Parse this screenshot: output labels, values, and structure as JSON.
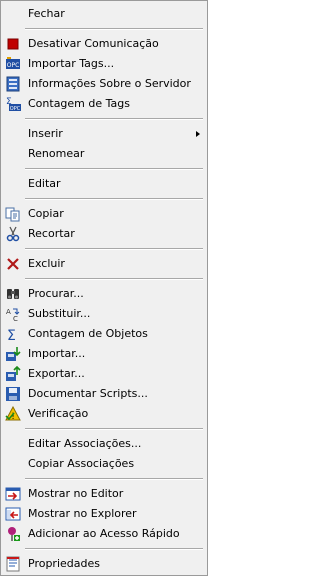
{
  "menu": {
    "fechar": "Fechar",
    "desativar": "Desativar Comunicação",
    "importar_tags": "Importar Tags...",
    "info_servidor": "Informações Sobre o Servidor",
    "contagem_tags": "Contagem de Tags",
    "inserir": "Inserir",
    "renomear": "Renomear",
    "editar": "Editar",
    "copiar": "Copiar",
    "recortar": "Recortar",
    "excluir": "Excluir",
    "procurar": "Procurar...",
    "substituir": "Substituir...",
    "contagem_objetos": "Contagem de Objetos",
    "importar": "Importar...",
    "exportar": "Exportar...",
    "documentar": "Documentar Scripts...",
    "verificacao": "Verificação",
    "editar_assoc": "Editar Associações...",
    "copiar_assoc": "Copiar Associações",
    "mostrar_editor": "Mostrar no Editor",
    "mostrar_explorer": "Mostrar no Explorer",
    "acesso_rapido": "Adicionar ao Acesso Rápido",
    "propriedades": "Propriedades"
  }
}
